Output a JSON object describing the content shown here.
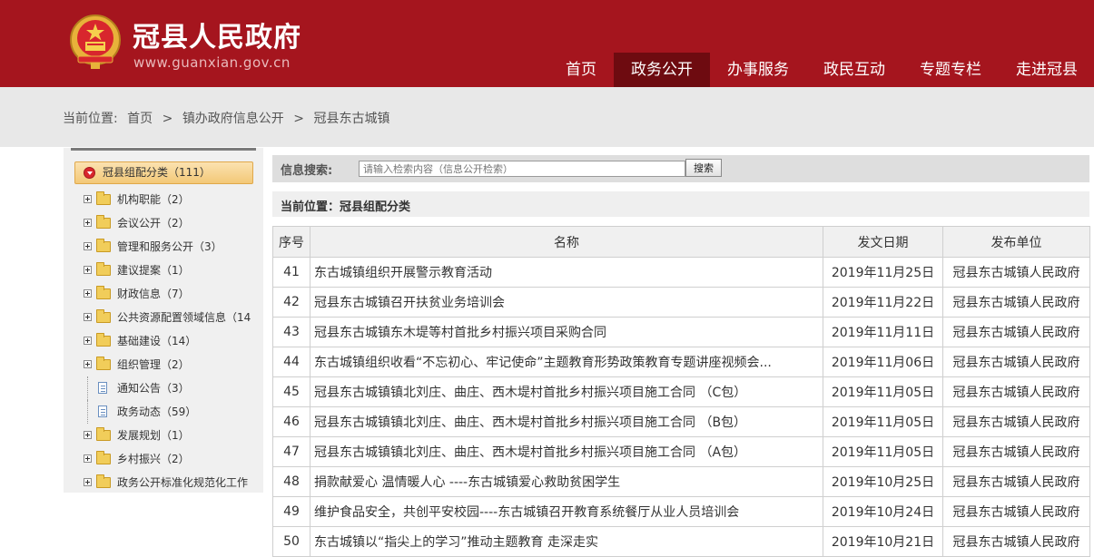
{
  "header": {
    "title": "冠县人民政府",
    "url": "www.guanxian.gov.cn",
    "nav": [
      {
        "label": "首页",
        "active": false
      },
      {
        "label": "政务公开",
        "active": true
      },
      {
        "label": "办事服务",
        "active": false
      },
      {
        "label": "政民互动",
        "active": false
      },
      {
        "label": "专题专栏",
        "active": false
      },
      {
        "label": "走进冠县",
        "active": false
      }
    ]
  },
  "breadcrumb": {
    "prefix": "当前位置:",
    "items": [
      "首页",
      "镇办政府信息公开",
      "冠县东古城镇"
    ],
    "separator": ">"
  },
  "sidebar": {
    "root": "冠县组配分类（111）",
    "items": [
      {
        "label": "机构职能（2）",
        "icon": "folder-icon"
      },
      {
        "label": "会议公开（2）",
        "icon": "folder-icon"
      },
      {
        "label": "管理和服务公开（3）",
        "icon": "folder-icon"
      },
      {
        "label": "建议提案（1）",
        "icon": "folder-icon"
      },
      {
        "label": "财政信息（7）",
        "icon": "folder-icon"
      },
      {
        "label": "公共资源配置领域信息（14",
        "icon": "folder-icon"
      },
      {
        "label": "基础建设（14）",
        "icon": "folder-icon"
      },
      {
        "label": "组织管理（2）",
        "icon": "folder-icon"
      },
      {
        "label": "通知公告（3）",
        "icon": "document-icon"
      },
      {
        "label": "政务动态（59）",
        "icon": "document-icon"
      },
      {
        "label": "发展规划（1）",
        "icon": "folder-icon"
      },
      {
        "label": "乡村振兴（2）",
        "icon": "folder-icon"
      },
      {
        "label": "政务公开标准化规范化工作",
        "icon": "folder-icon"
      }
    ]
  },
  "search": {
    "label": "信息搜索:",
    "placeholder": "请输入检索内容（信息公开检索）",
    "button": "搜索"
  },
  "location": {
    "text": "当前位置：冠县组配分类"
  },
  "table": {
    "columns": [
      "序号",
      "名称",
      "发文日期",
      "发布单位"
    ],
    "rows": [
      {
        "num": "41",
        "name": "东古城镇组织开展警示教育活动",
        "date": "2019年11月25日",
        "unit": "冠县东古城镇人民政府"
      },
      {
        "num": "42",
        "name": "冠县东古城镇召开扶贫业务培训会",
        "date": "2019年11月22日",
        "unit": "冠县东古城镇人民政府"
      },
      {
        "num": "43",
        "name": "冠县东古城镇东木堤等村首批乡村振兴项目采购合同",
        "date": "2019年11月11日",
        "unit": "冠县东古城镇人民政府"
      },
      {
        "num": "44",
        "name": "东古城镇组织收看“不忘初心、牢记使命”主题教育形势政策教育专题讲座视频会...",
        "date": "2019年11月06日",
        "unit": "冠县东古城镇人民政府"
      },
      {
        "num": "45",
        "name": "冠县东古城镇镇北刘庄、曲庄、西木堤村首批乡村振兴项目施工合同 （C包）",
        "date": "2019年11月05日",
        "unit": "冠县东古城镇人民政府"
      },
      {
        "num": "46",
        "name": "冠县东古城镇镇北刘庄、曲庄、西木堤村首批乡村振兴项目施工合同 （B包）",
        "date": "2019年11月05日",
        "unit": "冠县东古城镇人民政府"
      },
      {
        "num": "47",
        "name": "冠县东古城镇镇北刘庄、曲庄、西木堤村首批乡村振兴项目施工合同 （A包）",
        "date": "2019年11月05日",
        "unit": "冠县东古城镇人民政府"
      },
      {
        "num": "48",
        "name": "捐款献爱心 温情暖人心 ----东古城镇爱心救助贫困学生",
        "date": "2019年10月25日",
        "unit": "冠县东古城镇人民政府"
      },
      {
        "num": "49",
        "name": "维护食品安全，共创平安校园----东古城镇召开教育系统餐厅从业人员培训会",
        "date": "2019年10月24日",
        "unit": "冠县东古城镇人民政府"
      },
      {
        "num": "50",
        "name": "东古城镇以“指尖上的学习”推动主题教育 走深走实",
        "date": "2019年10月21日",
        "unit": "冠县东古城镇人民政府"
      }
    ]
  },
  "colors": {
    "header_red": "#a5151e",
    "nav_active": "#6e0b10",
    "crumb_band": "#e8e8e8"
  }
}
